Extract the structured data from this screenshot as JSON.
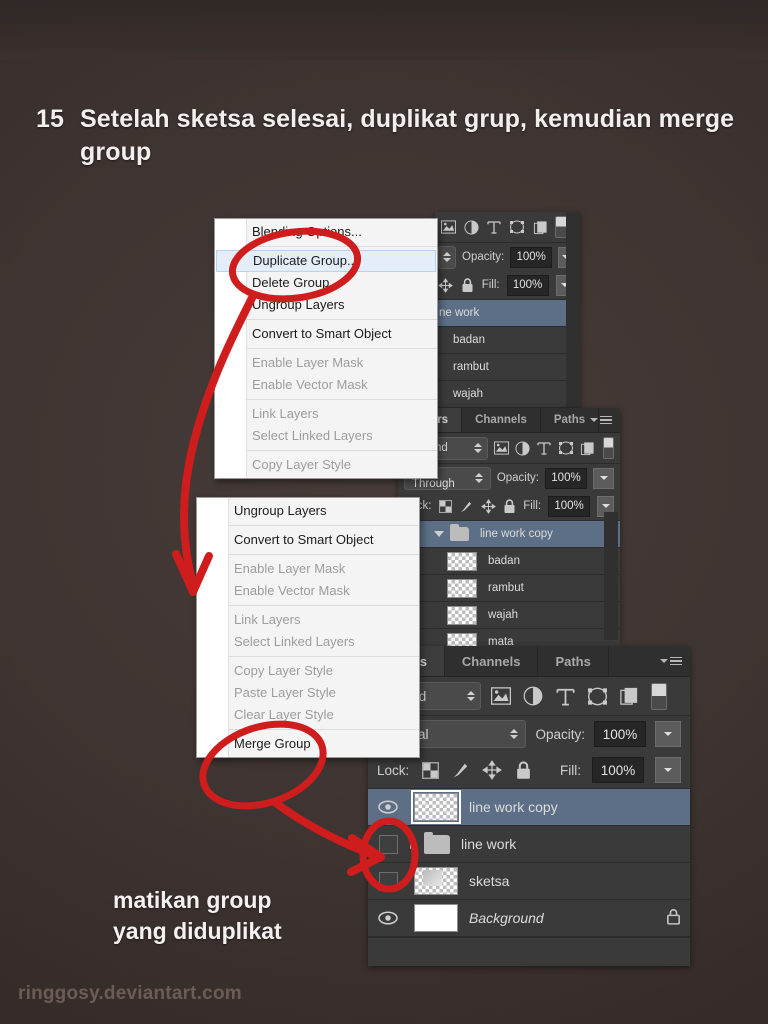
{
  "heading": {
    "number": "15",
    "text": "Setelah sketsa selesai, duplikat grup, kemudian merge group"
  },
  "annotation": {
    "line1": "matikan group",
    "line2": "yang diduplikat"
  },
  "watermark": "ringgosy.deviantart.com",
  "colors": {
    "marker_red": "#d31f1f",
    "panel_bg": "#3a3a3a",
    "selected_row": "#5c6f86",
    "menu_bg": "#f4f4f4",
    "background": "#3a302e"
  },
  "context_menu_top": {
    "items": [
      {
        "label": "Blending Options...",
        "state": "enabled"
      },
      {
        "label": "Duplicate Group...",
        "state": "highlighted"
      },
      {
        "label": "Delete Group",
        "state": "enabled"
      },
      {
        "label": "Ungroup Layers",
        "state": "enabled"
      },
      {
        "label": "Convert to Smart Object",
        "state": "enabled"
      },
      {
        "label": "Enable Layer Mask",
        "state": "disabled"
      },
      {
        "label": "Enable Vector Mask",
        "state": "disabled"
      },
      {
        "label": "Link Layers",
        "state": "disabled"
      },
      {
        "label": "Select Linked Layers",
        "state": "disabled"
      },
      {
        "label": "Copy Layer Style",
        "state": "disabled"
      }
    ]
  },
  "context_menu_bottom": {
    "items": [
      {
        "label": "Ungroup Layers",
        "state": "enabled"
      },
      {
        "label": "Convert to Smart Object",
        "state": "enabled"
      },
      {
        "label": "Enable Layer Mask",
        "state": "disabled"
      },
      {
        "label": "Enable Vector Mask",
        "state": "disabled"
      },
      {
        "label": "Link Layers",
        "state": "disabled"
      },
      {
        "label": "Select Linked Layers",
        "state": "disabled"
      },
      {
        "label": "Copy Layer Style",
        "state": "disabled"
      },
      {
        "label": "Paste Layer Style",
        "state": "disabled"
      },
      {
        "label": "Clear Layer Style",
        "state": "disabled"
      },
      {
        "label": "Merge Group",
        "state": "enabled"
      }
    ]
  },
  "panel_1": {
    "opacity_label": "Opacity:",
    "opacity_value": "100%",
    "fill_label": "Fill:",
    "fill_value": "100%",
    "layers": [
      {
        "name": "ne work",
        "selected": true
      },
      {
        "name": "badan",
        "selected": false
      },
      {
        "name": "rambut",
        "selected": false
      },
      {
        "name": "wajah",
        "selected": false
      }
    ]
  },
  "panel_2": {
    "tabs": [
      {
        "label": "Layers",
        "active": true
      },
      {
        "label": "Channels",
        "active": false
      },
      {
        "label": "Paths",
        "active": false
      }
    ],
    "filter_kind": "Kind",
    "blend_mode": "Pass Through",
    "opacity_label": "Opacity:",
    "opacity_value": "100%",
    "lock_label": "Lock:",
    "fill_label": "Fill:",
    "fill_value": "100%",
    "layers": [
      {
        "name": "line work copy",
        "type": "group",
        "selected": true,
        "expanded": true
      },
      {
        "name": "badan",
        "type": "layer",
        "selected": false
      },
      {
        "name": "rambut",
        "type": "layer",
        "selected": false
      },
      {
        "name": "wajah",
        "type": "layer",
        "selected": false
      },
      {
        "name": "mata",
        "type": "layer",
        "selected": false
      }
    ]
  },
  "panel_3": {
    "tabs": [
      {
        "label": "Layers",
        "active": true
      },
      {
        "label": "Channels",
        "active": false
      },
      {
        "label": "Paths",
        "active": false
      }
    ],
    "filter_kind": "Kind",
    "blend_mode": "Normal",
    "opacity_label": "Opacity:",
    "opacity_value": "100%",
    "lock_label": "Lock:",
    "fill_label": "Fill:",
    "fill_value": "100%",
    "layers": [
      {
        "name": "line work copy",
        "type": "layer",
        "visible": true,
        "selected": true,
        "locked": false
      },
      {
        "name": "line work",
        "type": "group",
        "visible": false,
        "selected": false,
        "locked": false
      },
      {
        "name": "sketsa",
        "type": "layer",
        "visible": false,
        "selected": false,
        "locked": false
      },
      {
        "name": "Background",
        "type": "layer",
        "visible": true,
        "selected": false,
        "locked": true
      }
    ]
  }
}
